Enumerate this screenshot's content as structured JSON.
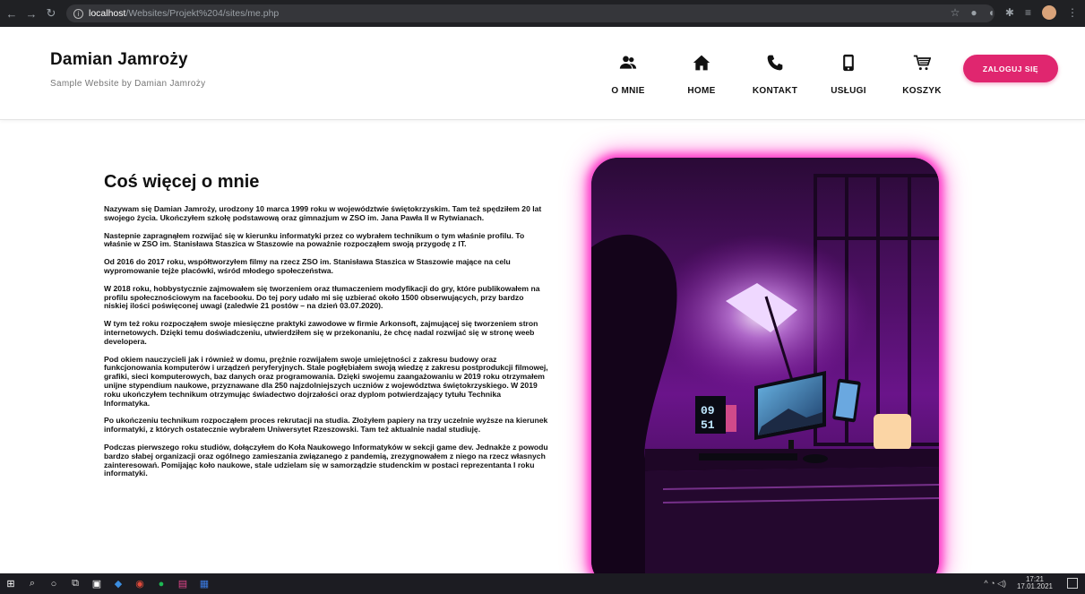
{
  "browser": {
    "url_host": "localhost",
    "url_path": "/Websites/Projekt%204/sites/me.php"
  },
  "header": {
    "name": "Damian Jamroży",
    "subtitle": "Sample Website by Damian Jamroży",
    "nav": [
      {
        "label": "O MNIE",
        "icon": "users-icon"
      },
      {
        "label": "HOME",
        "icon": "home-icon"
      },
      {
        "label": "KONTAKT",
        "icon": "phone-icon"
      },
      {
        "label": "USŁUGI",
        "icon": "mobile-icon"
      },
      {
        "label": "KOSZYK",
        "icon": "cart-icon"
      }
    ],
    "login_label": "ZALOGUJ SIĘ"
  },
  "main": {
    "title": "Coś więcej o mnie",
    "paragraphs": [
      "Nazywam się Damian Jamroży, urodzony 10 marca 1999 roku w województwie świętokrzyskim. Tam też spędziłem 20 lat swojego życia. Ukończyłem szkołę podstawową oraz gimnazjum w ZSO im. Jana Pawła II w Rytwianach.",
      "Nastepnie zapragnąłem rozwijać się w kierunku informatyki przez co wybrałem technikum o tym właśnie profilu. To właśnie w ZSO im. Stanisława Staszica w Staszowie na poważnie rozpocząłem swoją przygodę z IT.",
      "Od 2016 do 2017 roku, współtworzyłem filmy na rzecz ZSO im. Stanisława Staszica w Staszowie mające na celu wypromowanie tejże placówki, wśród młodego społeczeństwa.",
      "W 2018 roku, hobbystycznie zajmowałem się tworzeniem oraz tłumaczeniem modyfikacji do gry, które publikowałem na profilu społecznościowym na facebooku. Do tej pory udało mi się uzbierać około 1500 obserwujących, przy bardzo niskiej ilości poświęconej uwagi (zaledwie 21 postów – na dzień 03.07.2020).",
      "W tym też roku rozpocząłem swoje miesięczne praktyki zawodowe w firmie Arkonsoft, zajmującej się tworzeniem stron internetowych. Dzięki temu doświadczeniu, utwierdziłem się w przekonaniu, że chcę nadal rozwijać się w stronę weeb developera.",
      "Pod okiem nauczycieli jak i również w domu, prężnie rozwijałem swoje umiejętności z zakresu budowy oraz funkcjonowania komputerów i urządzeń peryferyjnych. Stale pogłębiałem swoją wiedzę z zakresu postprodukcji filmowej, grafiki, sieci komputerowych, baz danych oraz programowania. Dzięki swojemu zaangażowaniu w 2019 roku otrzymałem unijne stypendium naukowe, przyznawane dla 250 najzdolniejszych uczniów z województwa świętokrzyskiego. W 2019 roku ukończyłem technikum otrzymując świadectwo dojrzałości oraz dyplom potwierdzający tytułu Technika Informatyka.",
      "Po ukończeniu technikum rozpocząłem proces rekrutacji na studia. Złożyłem papiery na trzy uczelnie wyższe na kierunek informatyki, z których ostatecznie wybrałem Uniwersytet Rzeszowski. Tam też aktualnie nadal studiuję.",
      "Podczas pierwszego roku studiów, dołączyłem do Koła Naukowego Informatyków w sekcji game dev. Jednakże z powodu bardzo słabej organizacji oraz ogólnego zamieszania związanego z pandemią, zrezygnowałem z niego na rzecz własnych zainteresowań. Pomijając koło naukowe, stale udzielam się w samorządzie studenckim w postaci reprezentanta I roku informatyki."
    ],
    "clock": "09 51"
  },
  "taskbar": {
    "time": "17:21",
    "date": "17.01.2021"
  },
  "colors": {
    "accent": "#e0266f",
    "glow": "#ff36c8"
  }
}
